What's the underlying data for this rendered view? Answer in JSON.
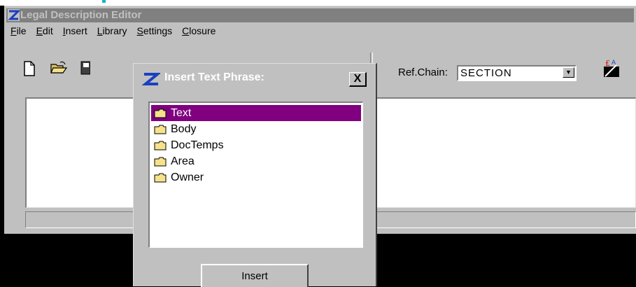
{
  "app": {
    "title": "Legal Description Editor",
    "icon": "app-logo-icon"
  },
  "menu": [
    "File",
    "Edit",
    "Insert",
    "Library",
    "Settings",
    "Closure"
  ],
  "toolbar": {
    "icons": [
      "new-document-icon",
      "open-folder-icon",
      "save-icon",
      "insert-phrase-icon"
    ],
    "refchain_label": "Ref.Chain:",
    "refchain_value": "SECTION"
  },
  "dialog": {
    "title": "Insert Text Phrase:",
    "close_label": "X",
    "items": [
      {
        "label": "Text",
        "selected": true
      },
      {
        "label": "Body",
        "selected": false
      },
      {
        "label": "DocTemps",
        "selected": false
      },
      {
        "label": "Area",
        "selected": false
      },
      {
        "label": "Owner",
        "selected": false
      }
    ],
    "insert_label": "Insert"
  },
  "colors": {
    "selection": "#800080",
    "face": "#c0c0c0",
    "inactive_title": "#808080"
  }
}
